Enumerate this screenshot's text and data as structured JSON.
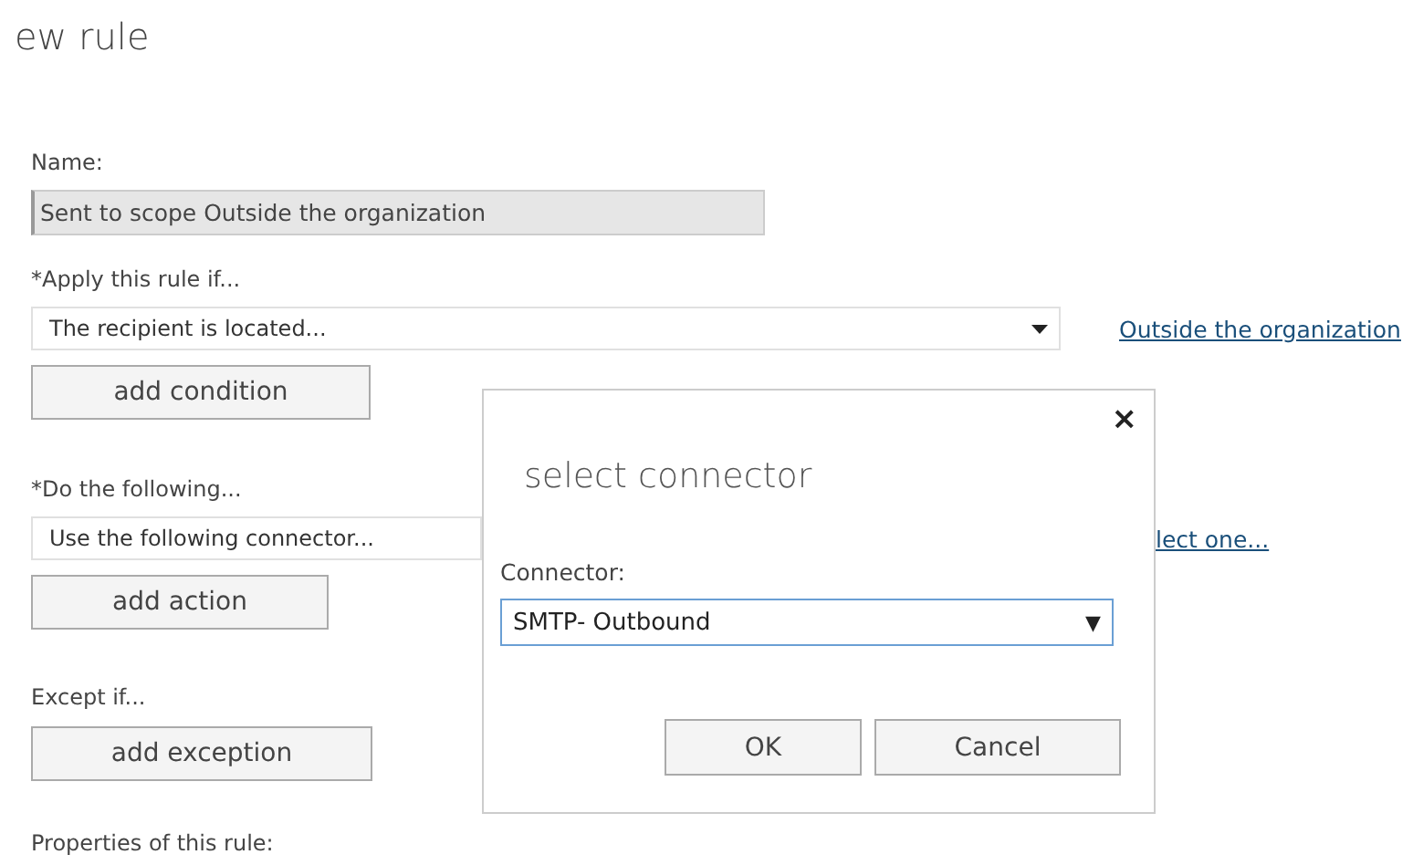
{
  "page_title": "ew rule",
  "name_field": {
    "label": "Name:",
    "value": "Sent to scope Outside the organization",
    "disabled": true
  },
  "sections": [
    {
      "label": "*Apply this rule if...",
      "dropdown": {
        "value": "The recipient is located...",
        "arrow": true
      },
      "link": "Outside the organization",
      "button": "add condition"
    },
    {
      "label": "*Do the following...",
      "dropdown": {
        "value": "Use the following connector..."
      },
      "link": "lect one...",
      "button": "add action"
    },
    {
      "label": "Except if...",
      "button": "add exception"
    }
  ],
  "properties_label": "Properties of this rule:",
  "dialog": {
    "close": "×",
    "title": "select connector",
    "field_label": "Connector:",
    "select": {
      "value": "SMTP- Outbound",
      "arrow": "▼",
      "focused": true
    },
    "buttons": [
      "OK",
      "Cancel"
    ]
  }
}
